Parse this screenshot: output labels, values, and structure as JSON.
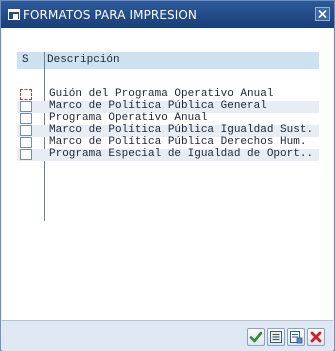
{
  "window": {
    "title": "FORMATOS PARA IMPRESION",
    "icon": "window-icon",
    "close_icon": "close-icon"
  },
  "table": {
    "columns": {
      "select": "S",
      "description": "Descripción"
    },
    "rows": [
      {
        "selected": false,
        "focused": true,
        "description": "Guión del Programa Operativo Anual"
      },
      {
        "selected": false,
        "focused": false,
        "description": "Marco de Política Pública General"
      },
      {
        "selected": false,
        "focused": false,
        "description": "Programa Operativo Anual"
      },
      {
        "selected": false,
        "focused": false,
        "description": "Marco de Política Pública Igualdad Sust."
      },
      {
        "selected": false,
        "focused": false,
        "description": "Marco de Política Pública Derechos Hum."
      },
      {
        "selected": false,
        "focused": false,
        "description": "Programa Especial de Igualdad de Oport.."
      }
    ]
  },
  "footer": {
    "buttons": [
      {
        "icon": "checkmark-icon",
        "color": "#2e8b2e"
      },
      {
        "icon": "list-icon",
        "color": "#2c5aa0"
      },
      {
        "icon": "document-icon",
        "color": "#2c5aa0"
      },
      {
        "icon": "cancel-icon",
        "color": "#d02020"
      }
    ]
  }
}
